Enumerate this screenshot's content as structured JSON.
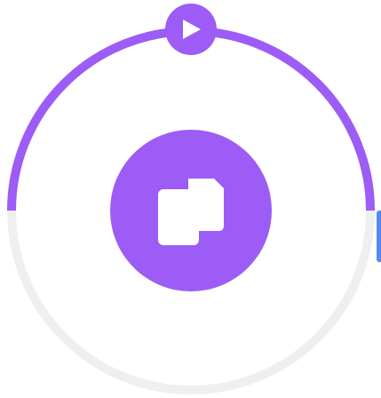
{
  "widget": {
    "progress_fraction": 0.5,
    "colors": {
      "accent": "#9d5cf5",
      "track": "#efefef",
      "icon": "#ffffff",
      "side_accent": "#5b86f0"
    },
    "icons": {
      "play_button": "play-icon",
      "center_button": "copy-files-icon"
    }
  }
}
